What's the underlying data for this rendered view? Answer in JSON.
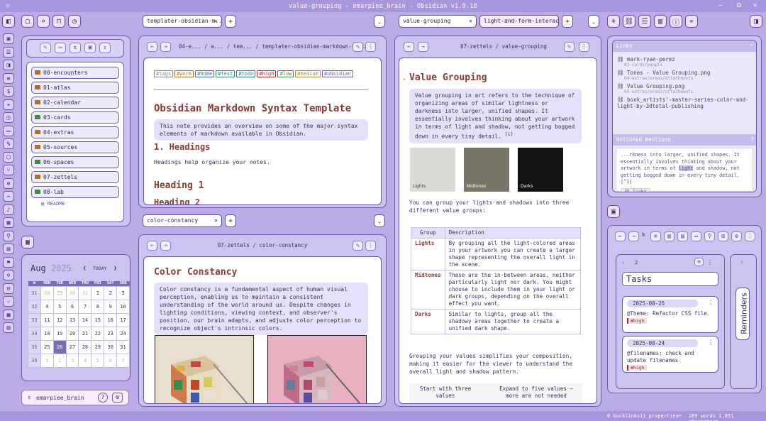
{
  "window": {
    "title": "value-grouping - emarpiee_brain - Obsidian v1.9.10"
  },
  "ribbon_icons": [
    "files-icon",
    "search-icon",
    "bookmark-icon",
    "graph-icon",
    "calendar-icon",
    "dollar-icon",
    "tag-icon",
    "layers-icon",
    "percent-icon",
    "cube-icon",
    "share-icon",
    "flow-icon",
    "terminal-icon",
    "mic-icon",
    "grid-icon",
    "zoom-icon",
    "note-icon",
    "flag-icon",
    "lock-icon",
    "lock2-icon",
    "star-icon",
    "image-icon",
    "box-icon"
  ],
  "ribbon_glyphs": [
    "▣",
    "☰",
    "◨",
    "≡",
    "$",
    "⌖",
    "◫",
    "▭",
    "%",
    "⬡",
    "⑂",
    "⊕",
    "⌁",
    "♪",
    "▦",
    "⚲",
    "▤",
    "⚑",
    "⊙",
    "⊡",
    "☆",
    "▩",
    "▥"
  ],
  "left_top_buttons": [
    "▢",
    "⌕",
    "⊓",
    "◷"
  ],
  "explorer": {
    "toolbar": [
      "✎",
      "▭",
      "⇅",
      "▣",
      "⇕"
    ],
    "folders": [
      {
        "name": "00-encounters",
        "color": "#b06d2a"
      },
      {
        "name": "01-atlas",
        "color": "#b06d2a"
      },
      {
        "name": "02-calendar",
        "color": "#b06d2a"
      },
      {
        "name": "03-cards",
        "color": "#3a8a3a"
      },
      {
        "name": "04-extras",
        "color": "#b06d2a"
      },
      {
        "name": "05-sources",
        "color": "#b06d2a"
      },
      {
        "name": "06-spaces",
        "color": "#3a8a3a"
      },
      {
        "name": "07-zettels",
        "color": "#b06d2a"
      },
      {
        "name": "08-lab",
        "color": "#3a8a3a"
      }
    ],
    "readme": "README"
  },
  "calendar": {
    "month": "Aug",
    "year": "2025",
    "today_label": "TODAY",
    "weekdays": [
      "W",
      "MON",
      "TUE",
      "WED",
      "THU",
      "FRI",
      "SAT",
      "SUN"
    ],
    "weeks": [
      {
        "wk": "31",
        "days": [
          "28",
          "29",
          "30",
          "31",
          "1",
          "2",
          "3"
        ],
        "dim": [
          1,
          1,
          1,
          1,
          0,
          0,
          0
        ]
      },
      {
        "wk": "32",
        "days": [
          "4",
          "5",
          "6",
          "7",
          "8",
          "9",
          "10"
        ],
        "dim": [
          0,
          0,
          0,
          0,
          0,
          0,
          0
        ]
      },
      {
        "wk": "33",
        "days": [
          "11",
          "12",
          "13",
          "14",
          "15",
          "16",
          "17"
        ],
        "dim": [
          0,
          0,
          0,
          0,
          0,
          0,
          0
        ]
      },
      {
        "wk": "34",
        "days": [
          "18",
          "19",
          "20",
          "21",
          "22",
          "23",
          "24"
        ],
        "dim": [
          0,
          0,
          0,
          0,
          0,
          0,
          0
        ]
      },
      {
        "wk": "35",
        "days": [
          "25",
          "26",
          "27",
          "28",
          "29",
          "30",
          "31"
        ],
        "dim": [
          0,
          0,
          0,
          0,
          0,
          0,
          0
        ]
      },
      {
        "wk": "36",
        "days": [
          "1",
          "2",
          "3",
          "4",
          "5",
          "6",
          "7"
        ],
        "dim": [
          1,
          1,
          1,
          1,
          1,
          1,
          1
        ]
      }
    ],
    "today_index": [
      4,
      1
    ]
  },
  "vault": {
    "name": "emarpiee_brain"
  },
  "pane1": {
    "tab": "templater-obsidian-m...",
    "breadcrumb": "04-e... / a... / tem... / templater-obsidian-markdown-syntax",
    "tags": [
      {
        "t": "#tags",
        "c": "#888"
      },
      {
        "t": "#work",
        "c": "#b06d2a"
      },
      {
        "t": "#home",
        "c": "#3a6ab0"
      },
      {
        "t": "#test",
        "c": "#2a8a6a"
      },
      {
        "t": "#todo",
        "c": "#2a7a9a"
      },
      {
        "t": "#high",
        "c": "#b03030"
      },
      {
        "t": "#low",
        "c": "#3a8a3a"
      },
      {
        "t": "#medium",
        "c": "#b08a2a"
      },
      {
        "t": "#obsidian",
        "c": "#6a5aa8"
      }
    ],
    "title": "Obsidian Markdown Syntax Template",
    "callout": "This note provides an overview on some of the major syntax elements of markdown available in Obsidian.",
    "h_headings": "1. Headings",
    "p_headings": "Headings help organize your notes.",
    "h1": "Heading 1",
    "h2": "Heading 2"
  },
  "pane2": {
    "tab": "color-constancy",
    "breadcrumb": "07-zettels / color-constancy",
    "title": "Color Constancy",
    "callout": "Color constancy is a fundamental aspect of human visual perception, enabling us to maintain a consistent understanding of the world around us. Despite changes in lighting conditions, viewing context, and observer's position, our brain adapts, and adjusts color perception to recognize object's intrinsic colors."
  },
  "pane3": {
    "tabs": [
      "value-grouping",
      "light-and-form-interaction"
    ],
    "breadcrumb": "07-zettels / value-grouping",
    "title": "Value Grouping",
    "callout": "Value grouping in art refers to the technique of organizing areas of similar lightness or darkness into larger, unified shapes. It essentially involves thinking about your artwork in terms of light and shadow, not getting bogged down in every tiny detail.",
    "footnote": "[1]",
    "swatches": [
      {
        "label": "Lights",
        "color": "#dcdcd6"
      },
      {
        "label": "Midtones",
        "color": "#777565"
      },
      {
        "label": "Darks",
        "color": "#141412"
      }
    ],
    "p1": "You can group your lights and shadows into three different value groups:",
    "table_headers": [
      "Group",
      "Description"
    ],
    "table_rows": [
      {
        "g": "Lights",
        "d": "By grouping all the light-colored areas in your artwork you can create a larger shape representing the overall light in the scene."
      },
      {
        "g": "Midtones",
        "d": "These are the in-between areas, neither particularly light nor dark. You might choose to include them in your light or dark groups, depending on the overall effect you want."
      },
      {
        "g": "Darks",
        "d": "Similar to lights, group all the shadowy areas together to create a unified dark shape."
      }
    ],
    "p2": "Grouping your values simplifies your composition, making it easier for the viewer to understand the overall light and shadow pattern.",
    "captions": [
      "Start with three values",
      "Expand to five values – more are not needed"
    ]
  },
  "links": {
    "header": "Links",
    "items": [
      {
        "name": "mark-ryan-perez",
        "sub": "03-cards/people"
      },
      {
        "name": "Tones - Value Grouping.png",
        "sub": "04-extras/areas/attachments"
      },
      {
        "name": "Value Grouping.png",
        "sub": "04-extras/areas/attachments"
      },
      {
        "name": "book_artists'-master-series-color-and-light-by-3dtotal-publishing",
        "sub": ""
      }
    ],
    "unlinked_header": "Unlinked mentions",
    "unlinked_count": "?",
    "mention_before": "...rkness into larger, unified shapes. It essentially involves thinking about your artwork in terms of ",
    "mention_hl": "light",
    "mention_after": " and shadow, not getting bogged down in every tiny detail. [^1]",
    "mention_tag": "light"
  },
  "tasks": {
    "count": "2",
    "title": "Tasks",
    "items": [
      {
        "date": "2025-08-25",
        "text": "@Theme: Refactor CSS file.",
        "tag": "#high"
      },
      {
        "date": "2025-08-24",
        "text": "@filenames: check and update filenames",
        "tag": "#high"
      }
    ],
    "reminders": "Reminders"
  },
  "status": {
    "backlinks": "0 backlinks",
    "properties": "11 properties",
    "words": "203 words 1,851 characters"
  }
}
